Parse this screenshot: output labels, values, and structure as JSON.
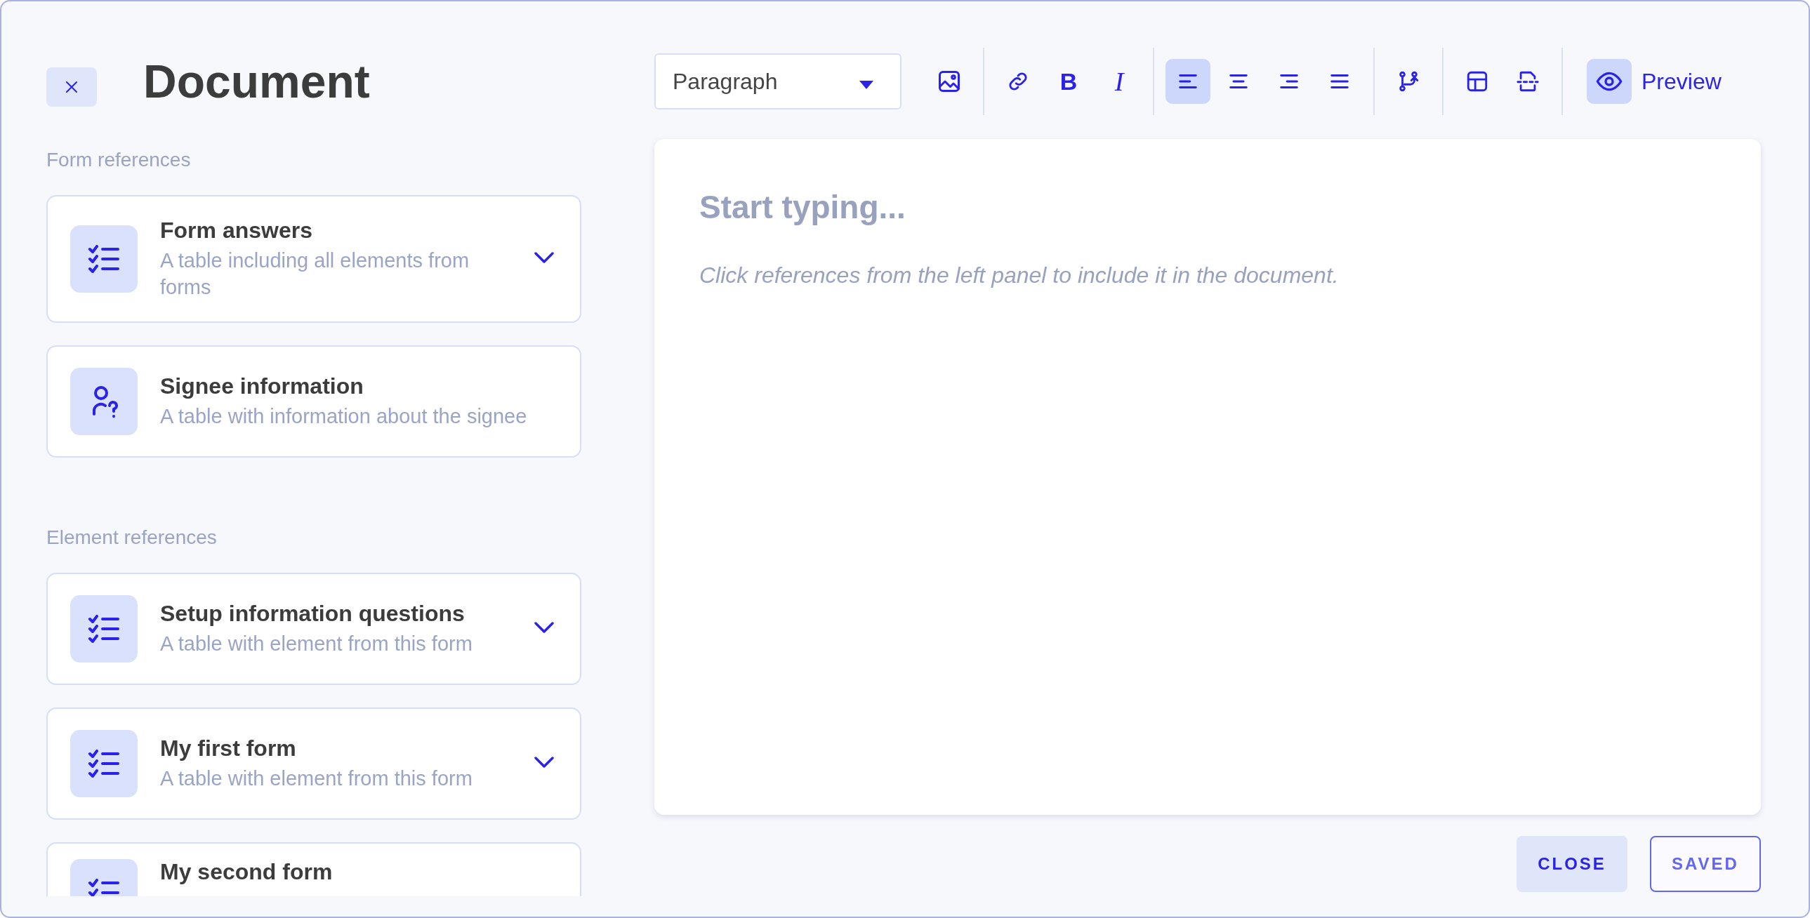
{
  "header": {
    "title": "Document"
  },
  "sections": [
    {
      "label": "Form references",
      "items": [
        {
          "kind": "checklist",
          "title": "Form answers",
          "description": "A table including all elements from forms",
          "expandable": true
        },
        {
          "kind": "person-question",
          "title": "Signee information",
          "description": "A table with information about the signee",
          "expandable": false
        }
      ]
    },
    {
      "label": "Element references",
      "items": [
        {
          "kind": "checklist",
          "title": "Setup information questions",
          "description": "A table with element from this form",
          "expandable": true
        },
        {
          "kind": "checklist",
          "title": "My first form",
          "description": "A table with element from this form",
          "expandable": true
        },
        {
          "kind": "checklist",
          "title": "My second form"
        }
      ]
    }
  ],
  "toolbar": {
    "block_format": "Paragraph",
    "groups": [
      [
        {
          "kind": "image",
          "selected": false
        }
      ],
      [
        {
          "kind": "link",
          "selected": false
        },
        {
          "kind": "bold",
          "text": "B",
          "selected": false
        },
        {
          "kind": "italic",
          "text": "I",
          "selected": false
        }
      ],
      [
        {
          "kind": "align-left",
          "selected": true
        },
        {
          "kind": "align-center",
          "selected": false
        },
        {
          "kind": "align-right",
          "selected": false
        },
        {
          "kind": "justify",
          "selected": false
        }
      ],
      [
        {
          "kind": "branch",
          "selected": false
        }
      ],
      [
        {
          "kind": "table",
          "selected": false
        },
        {
          "kind": "page-break",
          "selected": false
        }
      ]
    ],
    "preview": {
      "label": "Preview"
    }
  },
  "editor": {
    "heading_placeholder": "Start typing...",
    "hint": "Click references from the left panel to include it in the document."
  },
  "buttons": [
    {
      "label": "CLOSE",
      "kind": "secondary"
    },
    {
      "label": "SAVED",
      "kind": "outline"
    }
  ]
}
